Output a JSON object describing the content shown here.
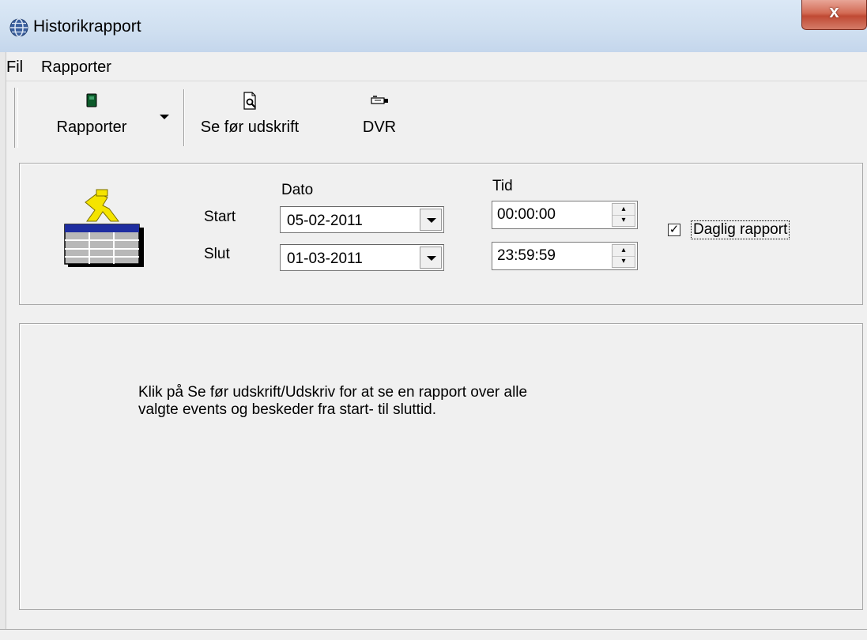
{
  "window": {
    "title": "Historikrapport",
    "close_label": "x",
    "icon": "globe-icon"
  },
  "menu": {
    "items": [
      {
        "label": "Fil"
      },
      {
        "label": "Rapporter"
      }
    ]
  },
  "toolbar": {
    "buttons": [
      {
        "label": "Rapporter",
        "icon": "report-book-icon",
        "has_dropdown": true
      },
      {
        "label": "Se før udskrift",
        "icon": "print-preview-icon"
      },
      {
        "label": "DVR",
        "icon": "dvr-camera-icon"
      }
    ]
  },
  "criteria": {
    "dato_header": "Dato",
    "tid_header": "Tid",
    "start_label": "Start",
    "slut_label": "Slut",
    "start_date": "05-02-2011",
    "slut_date": "01-03-2011",
    "start_time": "00:00:00",
    "slut_time": "23:59:59",
    "daily_report_label": "Daglig rapport",
    "daily_report_checked": true,
    "illustration_icon": "report-table-person-icon"
  },
  "info": {
    "line1": "Klik på Se før udskrift/Udskriv for at se en rapport over alle",
    "line2": "valgte events og beskeder fra start- til sluttid."
  },
  "colors": {
    "window_bg": "#f0f0f0",
    "close_button": "#c9553f",
    "titlebar": "#cfdff0"
  }
}
